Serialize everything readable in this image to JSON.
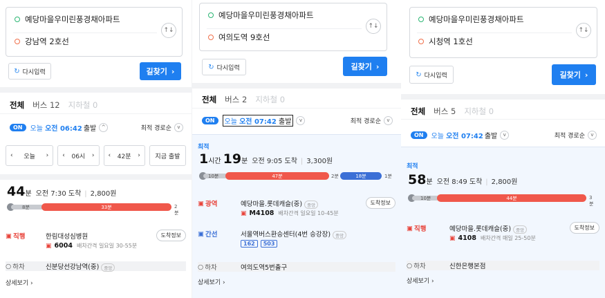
{
  "panels": [
    {
      "origin": "예당마을우미린풍경채아파트",
      "destination": "강남역 2호선",
      "reset_label": "다시입력",
      "search_label": "길찾기",
      "tabs": {
        "all": "전체",
        "bus": "버스 12",
        "subway": "지하철 0"
      },
      "time": {
        "on": "ON",
        "today": "오늘",
        "time": "오전 06:42",
        "depart": "출발"
      },
      "sort_label": "최적 경로순",
      "controls": {
        "day": "오늘",
        "hour": "06시",
        "minute": "42분",
        "now": "지금 출발"
      },
      "route": {
        "duration_min": "44",
        "min_unit": "분",
        "arrive": "오전 7:30 도착",
        "fare": "2,800원",
        "bar": {
          "walk1": "8분",
          "ride": "33분",
          "walk2": "2분"
        },
        "steps": [
          {
            "type": "직행",
            "stop": "한림대성심병원",
            "bus": "6004",
            "interval": "배차간격 일요일 30-55분",
            "info": "도착정보"
          },
          {
            "type": "하차",
            "stop": "신분당선강남역(중)",
            "badge": "중앙"
          }
        ],
        "more": "상세보기"
      }
    },
    {
      "origin": "예당마을우미린풍경채아파트",
      "destination": "여의도역 9호선",
      "reset_label": "다시입력",
      "search_label": "길찾기",
      "tabs": {
        "all": "전체",
        "bus": "버스 2",
        "subway": "지하철 0"
      },
      "time": {
        "on": "ON",
        "today": "오늘",
        "time": "오전 07:42",
        "depart": "출발"
      },
      "sort_label": "최적 경로순",
      "route": {
        "best": "최적",
        "hours": "1",
        "hour_unit": "시간",
        "duration_min": "19",
        "min_unit": "분",
        "arrive": "오전 9:05 도착",
        "fare": "3,300원",
        "bar": {
          "walk1": "10분",
          "ride1": "47분",
          "walk2": "2분",
          "ride2": "18분",
          "walk3": "1분"
        },
        "steps": [
          {
            "type": "광역",
            "stop": "예당마을.롯데캐슬(중)",
            "badge": "중앙",
            "bus": "M4108",
            "interval": "배차간격 일요일 10-45분",
            "info": "도착정보"
          },
          {
            "type": "간선",
            "stop": "서울역버스환승센터(4번 승강장)",
            "badge": "중앙",
            "chips": [
              "162",
              "503"
            ]
          },
          {
            "type": "하차",
            "stop": "여의도역5번출구"
          }
        ],
        "more": "상세보기"
      }
    },
    {
      "origin": "예당마을우미린풍경채아파트",
      "destination": "시청역 1호선",
      "reset_label": "다시입력",
      "search_label": "길찾기",
      "tabs": {
        "all": "전체",
        "bus": "버스 5",
        "subway": "지하철 0"
      },
      "time": {
        "on": "ON",
        "today": "오늘",
        "time": "오전 07:42",
        "depart": "출발"
      },
      "sort_label": "최적 경로순",
      "route": {
        "best": "최적",
        "duration_min": "58",
        "min_unit": "분",
        "arrive": "오전 8:49 도착",
        "fare": "2,800원",
        "bar": {
          "walk1": "10분",
          "ride": "44분",
          "walk2": "3분"
        },
        "steps": [
          {
            "type": "직행",
            "stop": "예당마을.롯데캐슬(중)",
            "badge": "중앙",
            "bus": "4108",
            "interval": "배차간격 매일 25-50분",
            "info": "도착정보"
          },
          {
            "type": "하차",
            "stop": "신한은행본점"
          }
        ],
        "more": "상세보기"
      }
    }
  ],
  "icons": {
    "swap": "swap-vertical-icon",
    "reset": "refresh-icon",
    "search": "chevron-right-icon",
    "bus": "bus-icon"
  },
  "colors": {
    "accent": "#1f7ff0",
    "bus_red": "#e8453c",
    "trunk_blue": "#3b6fd6",
    "ride_bar": "#f0584b"
  }
}
